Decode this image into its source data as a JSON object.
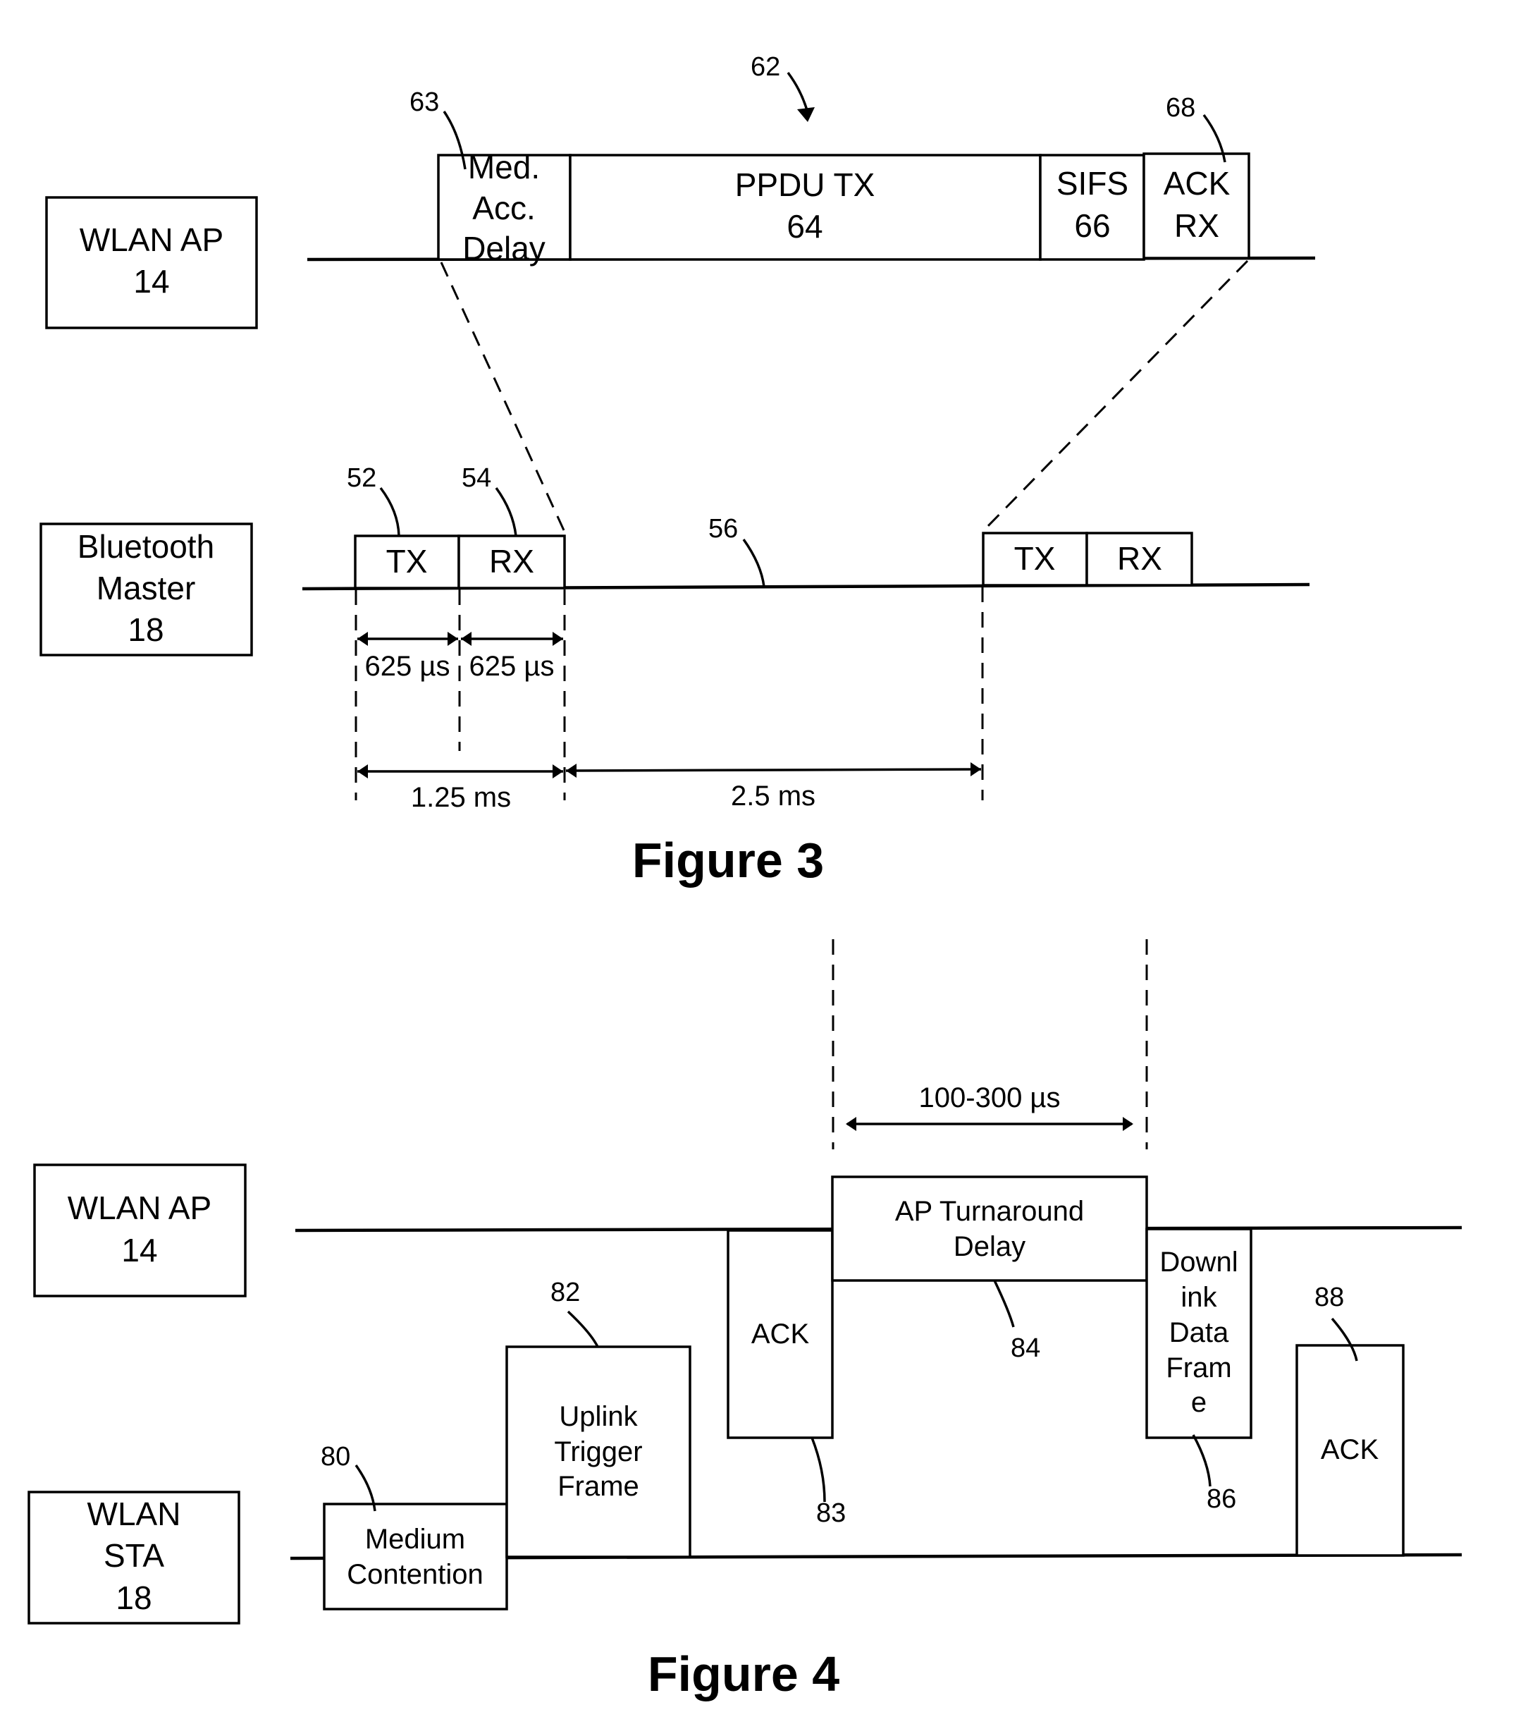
{
  "figure3": {
    "caption": "Figure 3",
    "wlan_ap_box": {
      "line1": "WLAN AP",
      "line2": "14"
    },
    "bluetooth_box": {
      "line1": "Bluetooth",
      "line2": "Master",
      "line3": "18"
    },
    "ap_frames": {
      "med_acc_delay": {
        "line1": "Med.",
        "line2": "Acc.",
        "line3": "Delay"
      },
      "ppdu_tx": {
        "line1": "PPDU TX",
        "line2": "64"
      },
      "sifs": {
        "line1": "SIFS",
        "line2": "66"
      },
      "ack_rx": {
        "line1": "ACK",
        "line2": "RX"
      }
    },
    "bt_slots": {
      "tx1": "TX",
      "rx1": "RX",
      "tx2": "TX",
      "rx2": "RX"
    },
    "refs": {
      "r62": "62",
      "r63": "63",
      "r68": "68",
      "r52": "52",
      "r54": "54",
      "r56": "56"
    },
    "timing": {
      "tx_slot": "625 µs",
      "rx_slot": "625 µs",
      "frame": "1.25 ms",
      "gap": "2.5 ms"
    }
  },
  "figure4": {
    "caption": "Figure 4",
    "wlan_ap_box": {
      "line1": "WLAN AP",
      "line2": "14"
    },
    "wlan_sta_box": {
      "line1": "WLAN",
      "line2": "STA",
      "line3": "18"
    },
    "frames": {
      "medium_contention": {
        "line1": "Medium",
        "line2": "Contention"
      },
      "uplink_trigger": {
        "line1": "Uplink",
        "line2": "Trigger",
        "line3": "Frame"
      },
      "ack_ap": "ACK",
      "ap_turnaround": {
        "line1": "AP Turnaround",
        "line2": "Delay"
      },
      "downlink": {
        "line1": "Downl",
        "line2": "ink",
        "line3": "Data",
        "line4": "Fram",
        "line5": "e"
      },
      "ack_sta": "ACK"
    },
    "refs": {
      "r80": "80",
      "r82": "82",
      "r83": "83",
      "r84": "84",
      "r86": "86",
      "r88": "88"
    },
    "timing": {
      "turnaround": "100-300 µs"
    }
  }
}
